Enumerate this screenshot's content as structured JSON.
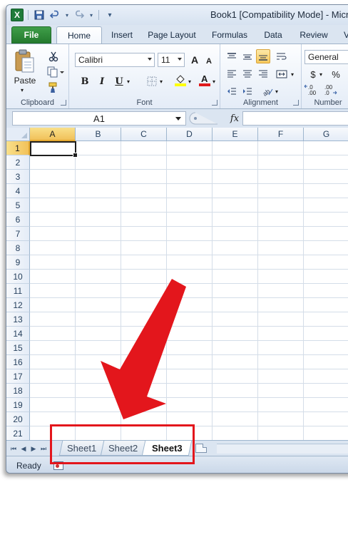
{
  "window": {
    "title": "Book1  [Compatibility Mode]  -  Micro",
    "app_logo": "X"
  },
  "ribbon_tabs": [
    {
      "label": "File"
    },
    {
      "label": "Home"
    },
    {
      "label": "Insert"
    },
    {
      "label": "Page Layout"
    },
    {
      "label": "Formulas"
    },
    {
      "label": "Data"
    },
    {
      "label": "Review"
    },
    {
      "label": "V"
    }
  ],
  "clipboard": {
    "paste_label": "Paste",
    "group_label": "Clipboard"
  },
  "font": {
    "font_name": "Calibri",
    "font_size": "11",
    "bold": "B",
    "italic": "I",
    "underline": "U",
    "grow": "A",
    "shrink": "A",
    "group_label": "Font"
  },
  "alignment": {
    "group_label": "Alignment"
  },
  "number": {
    "format": "General",
    "currency": "$",
    "percent": "%",
    "inc_decimal": "←.0 .00",
    "dec_decimal": ".00 →.0",
    "group_label": "Number"
  },
  "formula_bar": {
    "name_box": "A1",
    "fx_label": "fx",
    "value": ""
  },
  "grid": {
    "columns": [
      "A",
      "B",
      "C",
      "D",
      "E",
      "F",
      "G"
    ],
    "rows": [
      "1",
      "2",
      "3",
      "4",
      "5",
      "6",
      "7",
      "8",
      "9",
      "10",
      "11",
      "12",
      "13",
      "14",
      "15",
      "16",
      "17",
      "18",
      "19",
      "20",
      "21"
    ],
    "active_cell": "A1"
  },
  "sheets": [
    {
      "label": "Sheet1",
      "active": false
    },
    {
      "label": "Sheet2",
      "active": false
    },
    {
      "label": "Sheet3",
      "active": true
    }
  ],
  "status": {
    "text": "Ready"
  },
  "colors": {
    "file_tab": "#2f8a3a",
    "annotation_red": "#e3161c",
    "selected_header": "#f1c15a"
  }
}
